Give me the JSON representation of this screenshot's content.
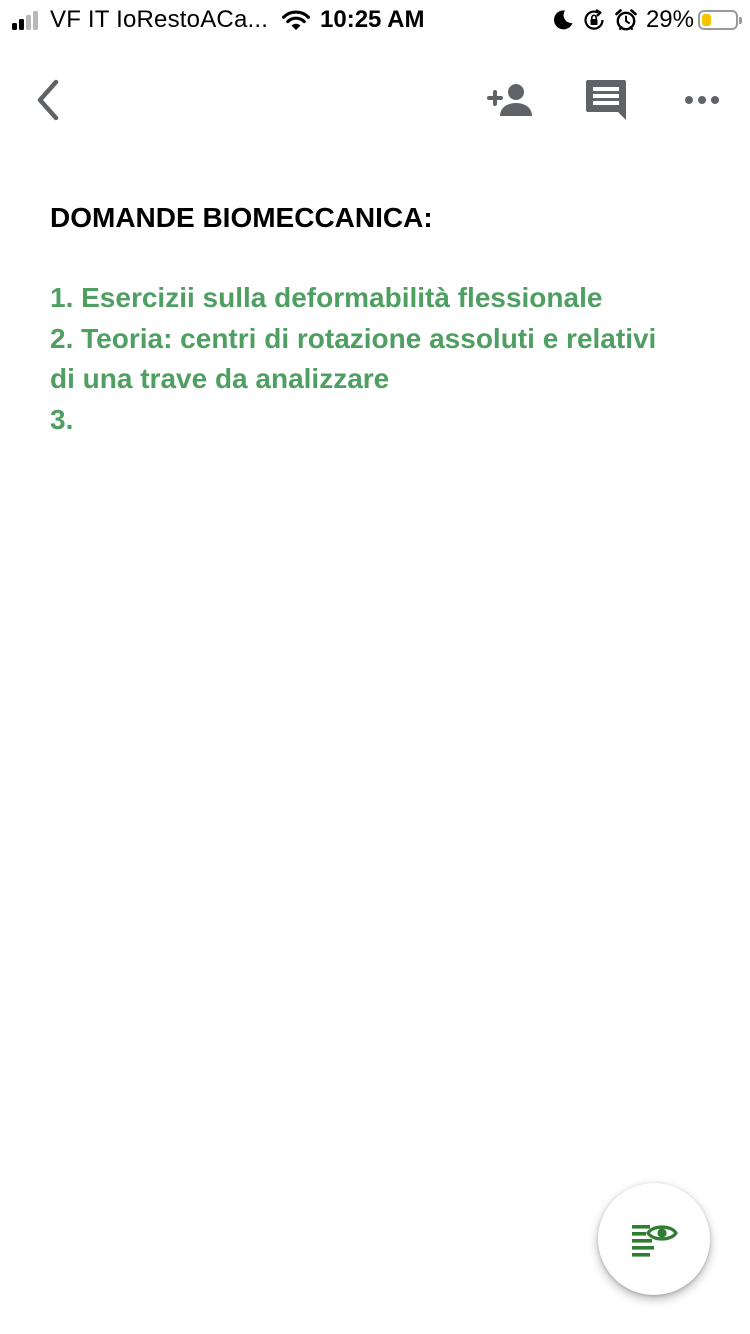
{
  "status_bar": {
    "carrier": "VF IT IoRestoACa...",
    "time": "10:25 AM",
    "battery_percent": "29%",
    "battery_level": 0.29,
    "signal_bars_active": 2,
    "signal_bars_total": 4,
    "icons": [
      "signal-icon",
      "wifi-icon",
      "moon-icon",
      "orientation-lock-icon",
      "alarm-icon",
      "battery-icon"
    ]
  },
  "toolbar": {
    "icons": [
      "back-arrow-icon",
      "add-person-icon",
      "comment-icon",
      "more-dots-icon"
    ]
  },
  "document": {
    "title": "DOMANDE BIOMECCANICA:",
    "lines": [
      "1. Esercizii sulla deformabilità flessionale",
      "2. Teoria: centri di rotazione assoluti e relativi",
      "di una trave da analizzare",
      "3."
    ]
  },
  "fab": {
    "icon": "view-mode-eye-icon"
  },
  "colors": {
    "text_green": "#4f9f63",
    "icon_gray": "#5f6368",
    "fab_green": "#2e7d32",
    "battery_yellow": "#f5c400"
  }
}
